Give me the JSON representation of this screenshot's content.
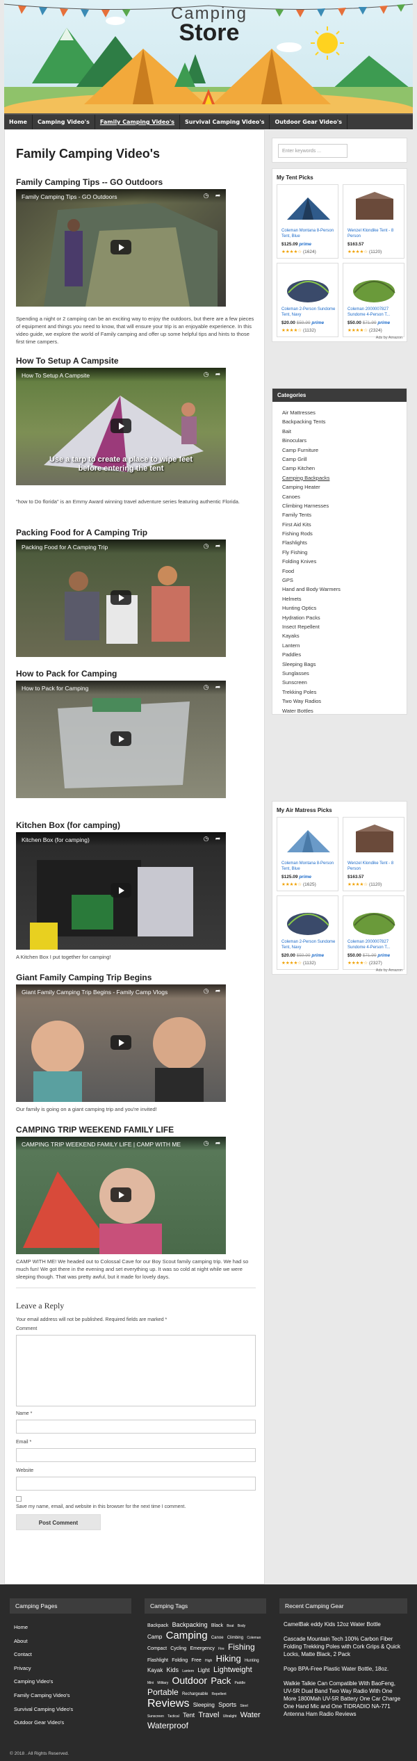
{
  "header": {
    "logo_top": "Camping",
    "logo_bottom": "Store"
  },
  "nav": {
    "items": [
      {
        "label": "Home"
      },
      {
        "label": "Camping Video's"
      },
      {
        "label": "Family Camping Video's"
      },
      {
        "label": "Survival Camping Video's"
      },
      {
        "label": "Outdoor Gear Video's"
      }
    ]
  },
  "main": {
    "page_title": "Family Camping Video's",
    "videos": [
      {
        "heading": "Family Camping Tips -- GO Outdoors",
        "player_title": "Family Camping Tips - GO Outdoors",
        "caption": "Spending a night or 2 camping can be an exciting way to enjoy the outdoors, but there are a few pieces of equipment and things you need to know, that will ensure your trip is an enjoyable experience. In this video guide, we explore the world of Family camping and offer up some helpful tips and hints to those first time campers."
      },
      {
        "heading": "How To Setup A Campsite",
        "player_title": "How To Setup A Campsite",
        "overlay": "Use a tarp to create a place to wipe feet before entering the tent",
        "caption": "\"how to Do florida\" is an Emmy Award winning travel adventure series featuring authentic Florida."
      },
      {
        "heading": "Packing Food for A Camping Trip",
        "player_title": "Packing Food for A Camping Trip",
        "caption": ""
      },
      {
        "heading": "How to Pack for Camping",
        "player_title": "How to Pack for Camping",
        "caption": ""
      },
      {
        "heading": "Kitchen Box (for camping)",
        "player_title": "Kitchen Box (for camping)",
        "caption": "A Kitchen Box I put together for camping!"
      },
      {
        "heading": "Giant Family Camping Trip Begins",
        "player_title": "Giant Family Camping Trip Begins - Family Camp Vlogs",
        "caption": "Our family is going on a giant camping trip and you're invited!"
      },
      {
        "heading": "CAMPING TRIP WEEKEND FAMILY LIFE",
        "player_title": "CAMPING TRIP WEEKEND FAMILY LIFE | CAMP WITH ME",
        "caption": "CAMP WITH ME! We headed out to Colossal Cave for our Boy Scout family camping trip. We had so much fun! We got there in the evening and set everything up. It was so cold at night while we were sleeping though. That was pretty awful, but it made for lovely days."
      }
    ]
  },
  "reply": {
    "title": "Leave a Reply",
    "note": "Your email address will not be published. Required fields are marked *",
    "comment_label": "Comment",
    "name_label": "Name *",
    "email_label": "Email *",
    "website_label": "Website",
    "save_label": "Save my name, email, and website in this browser for the next time I comment.",
    "submit_label": "Post Comment"
  },
  "sidebar": {
    "search_placeholder": "Enter keywords ...",
    "tent_title": "My Tent Picks",
    "air_title": "My Air Matress Picks",
    "ads_by": "Ads by Amazon",
    "tents": [
      {
        "name": "Coleman Montana 8-Person Tent, Blue",
        "price": "$125.09",
        "old": "",
        "prime": "prime",
        "stars": "★★★★☆",
        "count": "(1624)"
      },
      {
        "name": "Wenzel Klondike Tent - 8 Person",
        "price": "$163.57",
        "old": "",
        "prime": "",
        "stars": "★★★★☆",
        "count": "(1120)"
      },
      {
        "name": "Coleman 2-Person Sundome Tent, Navy",
        "price": "$20.00",
        "old": "$59.99",
        "prime": "prime",
        "stars": "★★★★☆",
        "count": "(1132)"
      },
      {
        "name": "Coleman 2000007827 Sundome 4-Person T...",
        "price": "$50.00",
        "old": "$71.99",
        "prime": "prime",
        "stars": "★★★★☆",
        "count": "(2324)"
      }
    ],
    "air": [
      {
        "name": "Coleman Montana 8-Person Tent, Blue",
        "price": "$125.09",
        "old": "",
        "prime": "prime",
        "stars": "★★★★☆",
        "count": "(1625)"
      },
      {
        "name": "Wenzel Klondike Tent - 8 Person",
        "price": "$163.57",
        "old": "",
        "prime": "",
        "stars": "★★★★☆",
        "count": "(1120)"
      },
      {
        "name": "Coleman 2-Person Sundome Tent, Navy",
        "price": "$20.00",
        "old": "$59.99",
        "prime": "prime",
        "stars": "★★★★☆",
        "count": "(1132)"
      },
      {
        "name": "Coleman 2000007827 Sundome 4-Person T...",
        "price": "$50.00",
        "old": "$71.99",
        "prime": "prime",
        "stars": "★★★★☆",
        "count": "(2327)"
      }
    ],
    "categories_title": "Categories",
    "categories": [
      "Air Mattresses",
      "Backpacking Tents",
      "Bait",
      "Binoculars",
      "Camp Furniture",
      "Camp Grill",
      "Camp Kitchen",
      "Camping Backpacks",
      "Camping Heater",
      "Canoes",
      "Climbing Harnesses",
      "Family Tents",
      "First Aid Kits",
      "Fishing Rods",
      "Flashlights",
      "Fly Fishing",
      "Folding Knives",
      "Food",
      "GPS",
      "Hand and Body Warmers",
      "Helmets",
      "Hunting Optics",
      "Hydration Packs",
      "Insect Repellent",
      "Kayaks",
      "Lantern",
      "Paddles",
      "Sleeping Bags",
      "Sunglasses",
      "Sunscreen",
      "Trekking Poles",
      "Two Way Radios",
      "Water Bottles"
    ]
  },
  "footer": {
    "pages_title": "Camping Pages",
    "pages": [
      "Home",
      "About",
      "Contact",
      "Privacy",
      "Camping Video's",
      "Family Camping Video's",
      "Survival Camping Video's",
      "Outdoor Gear Video's"
    ],
    "tags_title": "Camping Tags",
    "tags": [
      {
        "t": "Backpack",
        "s": 7
      },
      {
        "t": "Backpacking",
        "s": 9
      },
      {
        "t": "Black",
        "s": 7
      },
      {
        "t": "Boat",
        "s": 5
      },
      {
        "t": "Body",
        "s": 5
      },
      {
        "t": "Camp",
        "s": 8
      },
      {
        "t": "Camping",
        "s": 15
      },
      {
        "t": "Canoe",
        "s": 6
      },
      {
        "t": "Climbing",
        "s": 6
      },
      {
        "t": "Coleman",
        "s": 5
      },
      {
        "t": "Compact",
        "s": 7
      },
      {
        "t": "Cycling",
        "s": 7
      },
      {
        "t": "Emergency",
        "s": 7
      },
      {
        "t": "Fire",
        "s": 5
      },
      {
        "t": "Fishing",
        "s": 12
      },
      {
        "t": "Flashlight",
        "s": 7
      },
      {
        "t": "Folding",
        "s": 7
      },
      {
        "t": "Free",
        "s": 7
      },
      {
        "t": "High",
        "s": 5
      },
      {
        "t": "Hiking",
        "s": 13
      },
      {
        "t": "Hunting",
        "s": 6
      },
      {
        "t": "Kayak",
        "s": 8
      },
      {
        "t": "Kids",
        "s": 9
      },
      {
        "t": "Lantern",
        "s": 5
      },
      {
        "t": "Light",
        "s": 8
      },
      {
        "t": "Lightweight",
        "s": 11
      },
      {
        "t": "Mini",
        "s": 5
      },
      {
        "t": "Military",
        "s": 5
      },
      {
        "t": "Outdoor",
        "s": 14
      },
      {
        "t": "Pack",
        "s": 13
      },
      {
        "t": "Paddle",
        "s": 5
      },
      {
        "t": "Portable",
        "s": 12
      },
      {
        "t": "Rechargeable",
        "s": 6
      },
      {
        "t": "Repellent",
        "s": 5
      },
      {
        "t": "Reviews",
        "s": 16
      },
      {
        "t": "Sleeping",
        "s": 8
      },
      {
        "t": "Sports",
        "s": 9
      },
      {
        "t": "Steel",
        "s": 5
      },
      {
        "t": "Sunscreen",
        "s": 5
      },
      {
        "t": "Tactical",
        "s": 5
      },
      {
        "t": "Tent",
        "s": 9
      },
      {
        "t": "Travel",
        "s": 11
      },
      {
        "t": "Ultralight",
        "s": 5
      },
      {
        "t": "Water",
        "s": 11
      },
      {
        "t": "Waterproof",
        "s": 12
      }
    ],
    "recent_title": "Recent Camping Gear",
    "recent": [
      "CamelBak eddy Kids 12oz Water Bottle",
      "Cascade Mountain Tech 100% Carbon Fiber Folding Trekking Poles with Cork Grips & Quick Locks, Matte Black, 2 Pack",
      "Pogo BPA-Free Plastic Water Bottle, 18oz.",
      "Walkie Talkie Can Compatible With BaoFeng, UV-5R Dual Band Two Way Radio With One More 1800Mah UV-5R Battery One Car Charge One Hand Mic and One TIDRADIO NA-771 Antenna Ham Radio Reviews"
    ],
    "copyright": "© 2018 . All Rights Reserved."
  },
  "colors": {
    "nav_bg": "#3b3b3b",
    "footer_bg": "#2b2b2b",
    "link_blue": "#1b6ac9",
    "tent_orange": "#f2a93b"
  }
}
